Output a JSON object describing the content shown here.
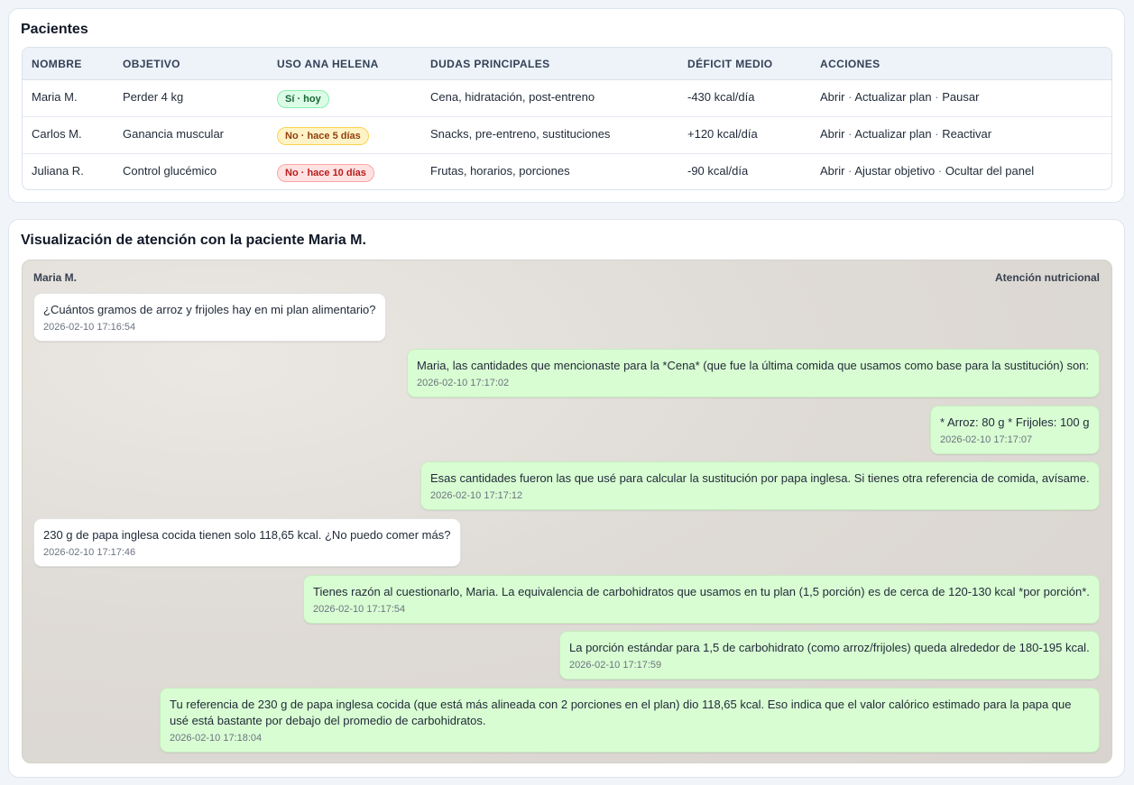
{
  "patients": {
    "title": "Pacientes",
    "columns": [
      "NOMBRE",
      "OBJETIVO",
      "USO ANA HELENA",
      "DUDAS PRINCIPALES",
      "DÉFICIT MEDIO",
      "ACCIONES"
    ],
    "rows": [
      {
        "name": "Maria M.",
        "goal": "Perder 4 kg",
        "usage": "Sí · hoy",
        "usage_status": "green",
        "doubts": "Cena, hidratación, post-entreno",
        "deficit": "-430 kcal/día",
        "actions": [
          "Abrir",
          "Actualizar plan",
          "Pausar"
        ]
      },
      {
        "name": "Carlos M.",
        "goal": "Ganancia muscular",
        "usage": "No · hace 5 días",
        "usage_status": "yellow",
        "doubts": "Snacks, pre-entreno, sustituciones",
        "deficit": "+120 kcal/día",
        "actions": [
          "Abrir",
          "Actualizar plan",
          "Reactivar"
        ]
      },
      {
        "name": "Juliana R.",
        "goal": "Control glucémico",
        "usage": "No · hace 10 días",
        "usage_status": "red",
        "doubts": "Frutas, horarios, porciones",
        "deficit": "-90 kcal/día",
        "actions": [
          "Abrir",
          "Ajustar objetivo",
          "Ocultar del panel"
        ]
      }
    ],
    "separator": "·"
  },
  "chat": {
    "title": "Visualización de atención con la paciente Maria M.",
    "header_left": "Maria M.",
    "header_right": "Atención nutricional",
    "messages": [
      {
        "side": "in",
        "text": "¿Cuántos gramos de arroz y frijoles hay en mi plan alimentario?",
        "time": "2026-02-10 17:16:54"
      },
      {
        "side": "out",
        "text": "Maria, las cantidades que mencionaste para la *Cena* (que fue la última comida que usamos como base para la sustitución) son:",
        "time": "2026-02-10 17:17:02"
      },
      {
        "side": "out",
        "text": "* Arroz: 80 g * Frijoles: 100 g",
        "time": "2026-02-10 17:17:07"
      },
      {
        "side": "out",
        "text": "Esas cantidades fueron las que usé para calcular la sustitución por papa inglesa. Si tienes otra referencia de comida, avísame.",
        "time": "2026-02-10 17:17:12"
      },
      {
        "side": "in",
        "text": "230 g de papa inglesa cocida tienen solo 118,65 kcal. ¿No puedo comer más?",
        "time": "2026-02-10 17:17:46"
      },
      {
        "side": "out",
        "text": "Tienes razón al cuestionarlo, Maria. La equivalencia de carbohidratos que usamos en tu plan (1,5 porción) es de cerca de 120-130 kcal *por porción*.",
        "time": "2026-02-10 17:17:54"
      },
      {
        "side": "out",
        "text": "La porción estándar para 1,5 de carbohidrato (como arroz/frijoles) queda alrededor de 180-195 kcal.",
        "time": "2026-02-10 17:17:59"
      },
      {
        "side": "out",
        "text": "Tu referencia de 230 g de papa inglesa cocida (que está más alineada con 2 porciones en el plan) dio 118,65 kcal. Eso indica que el valor calórico estimado para la papa que usé está bastante por debajo del promedio de carbohidratos.",
        "time": "2026-02-10 17:18:04"
      }
    ]
  }
}
